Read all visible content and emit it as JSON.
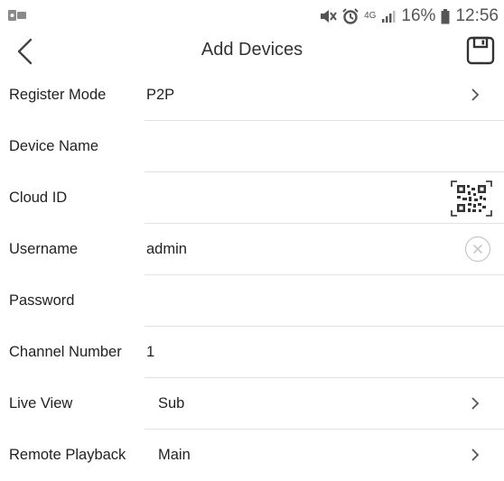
{
  "status_bar": {
    "network": "4G",
    "battery": "16%",
    "time": "12:56"
  },
  "header": {
    "title": "Add Devices",
    "back_icon": "chevron-left-icon",
    "save_icon": "floppy-disk-icon"
  },
  "form": {
    "register_mode": {
      "label": "Register Mode",
      "value": "P2P"
    },
    "device_name": {
      "label": "Device Name",
      "value": ""
    },
    "cloud_id": {
      "label": "Cloud ID",
      "value": "",
      "icon": "qr-code-scan-icon"
    },
    "username": {
      "label": "Username",
      "value": "admin",
      "icon": "clear-icon"
    },
    "password": {
      "label": "Password",
      "value": ""
    },
    "channel_number": {
      "label": "Channel Number",
      "value": "1"
    },
    "live_view": {
      "label": "Live View",
      "value": "Sub"
    },
    "remote_playback": {
      "label": "Remote Playback",
      "value": "Main"
    }
  },
  "colors": {
    "divider": "#e2e2e2",
    "text": "#222222",
    "icon": "#555555"
  }
}
